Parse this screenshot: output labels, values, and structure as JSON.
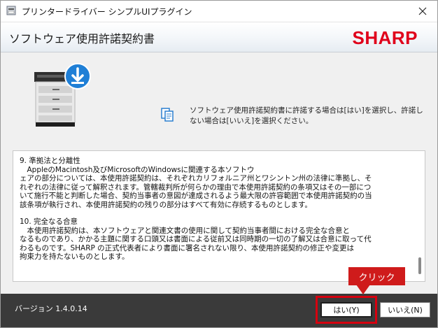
{
  "window": {
    "title": "プリンタードライバー シンプルUIプラグイン"
  },
  "banner": {
    "heading": "ソフトウェア使用許諾契約書",
    "brand": "SHARP"
  },
  "instruction": {
    "line1": "ソフトウェア使用許諾契約書に許諾する場合は[はい]を選択し、許諾し",
    "line2": "ない場合は[いいえ]を選択ください。"
  },
  "license": {
    "lines_a": [
      "9. 準拠法と分離性",
      "　AppleのMacintosh及びMicrosoftのWindowsに関連する本ソフトウ",
      "ェアの部分については、本使用許諾契約は、それぞれカリフォルニア州とワシントン州の法律に準拠し、そ",
      "れぞれの法律に従って解釈されます。管轄裁判所が何らかの理由で本使用許諾契約の条項又はその一部につ",
      "いて施行不能と判断した場合、契約当事者の意図が達成されるよう最大限の許容範囲で本使用許諾契約の当",
      "該条項が執行され、本使用許諾契約の残りの部分はすべて有効に存続するものとします。"
    ],
    "lines_b": [
      "10. 完全なる合意",
      "　本使用許諾契約は、本ソフトウェアと関連文書の使用に関して契約当事者間における完全な合意と",
      "なるものであり、かかる主題に関する口頭又は書面による従前又は同時期の一切の了解又は合意に取って代",
      "わるものです。SHARP の正式代表者により書面に署名されない限り、本使用許諾契約の修正や変更は",
      "拘束力を持たないものとします。"
    ]
  },
  "footer": {
    "version": "バージョン 1.4.0.14",
    "yes_label": "はい(Y)",
    "no_label": "いいえ(N)"
  },
  "annotation": {
    "callout": "クリック"
  },
  "colors": {
    "brand_red": "#e0001b",
    "callout_red": "#cf1b1b",
    "footer_bg": "#3a3a3a",
    "download_blue": "#1f7fd6"
  },
  "icons": {
    "app": "printer-app-icon",
    "close": "close-icon",
    "printer": "printer-download-icon",
    "doc": "document-copy-icon"
  }
}
